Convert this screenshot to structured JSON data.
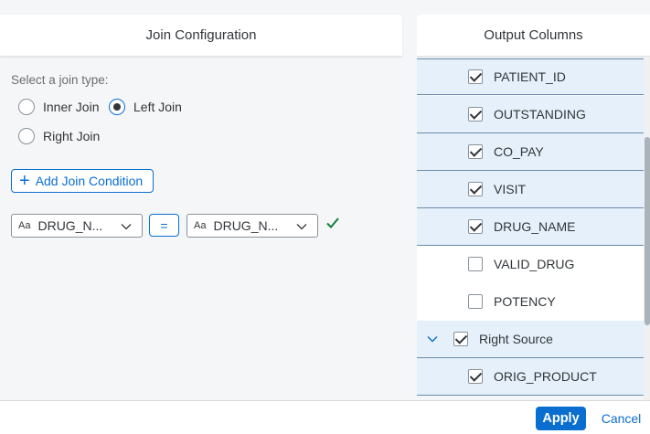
{
  "join_config": {
    "title": "Join Configuration",
    "join_type_label": "Select a join type:",
    "options": [
      {
        "label": "Inner Join",
        "checked": false
      },
      {
        "label": "Left Join",
        "checked": true
      },
      {
        "label": "Right Join",
        "checked": false
      }
    ],
    "add_condition_label": "Add Join Condition",
    "condition": {
      "left_icon": "Aa",
      "left_value": "DRUG_N...",
      "operator": "=",
      "right_icon": "Aa",
      "right_value": "DRUG_N..."
    }
  },
  "output_columns": {
    "title": "Output Columns",
    "rows": [
      {
        "label": "PATIENT_ID",
        "checked": true
      },
      {
        "label": "OUTSTANDING",
        "checked": true
      },
      {
        "label": "CO_PAY",
        "checked": true
      },
      {
        "label": "VISIT",
        "checked": true
      },
      {
        "label": "DRUG_NAME",
        "checked": true
      },
      {
        "label": "VALID_DRUG",
        "checked": false
      },
      {
        "label": "POTENCY",
        "checked": false
      },
      {
        "label": "Right Source",
        "checked": true,
        "group": true
      },
      {
        "label": "ORIG_PRODUCT",
        "checked": true
      }
    ]
  },
  "footer": {
    "apply_label": "Apply",
    "cancel_label": "Cancel"
  },
  "colors": {
    "accent": "#0a6ed1",
    "success": "#107e3e",
    "selected_row": "#e5f0fa"
  }
}
